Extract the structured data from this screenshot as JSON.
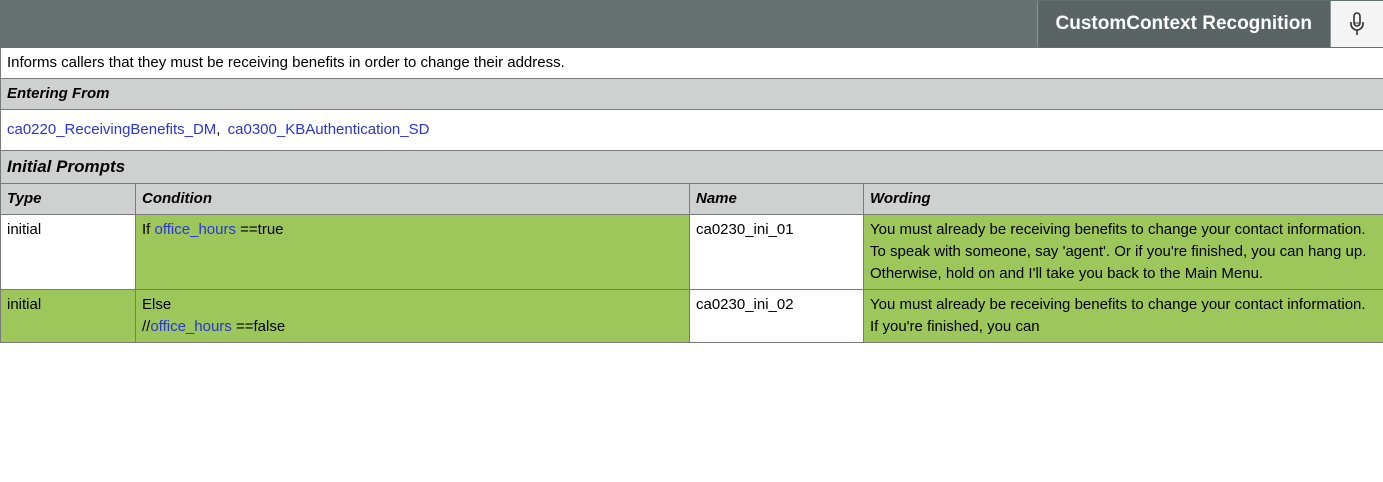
{
  "header": {
    "title": "CustomContext Recognition",
    "icon": "microphone-icon"
  },
  "description": "Informs callers that they must be receiving benefits in order to change their address.",
  "entering_from": {
    "label": "Entering From",
    "links": [
      "ca0220_ReceivingBenefits_DM",
      "ca0300_KBAuthentication_SD"
    ],
    "separator": ","
  },
  "initial_prompts": {
    "label": "Initial Prompts",
    "columns": [
      "Type",
      "Condition",
      "Name",
      "Wording"
    ],
    "rows": [
      {
        "type": "initial",
        "condition_prefix": "If ",
        "condition_link": "office_hours",
        "condition_suffix": " ==true",
        "name": "ca0230_ini_01",
        "wording": "You must already be receiving benefits to change your contact information. To speak with someone, say 'agent'. Or if you're finished, you can hang up. Otherwise, hold on and I'll take you back to the Main Menu."
      },
      {
        "type": "initial",
        "condition_line1": "Else",
        "condition_prefix2": "//",
        "condition_link2": "office_hours",
        "condition_suffix2": " ==false",
        "name": "ca0230_ini_02",
        "wording": "You must already be receiving benefits to change your contact information. If you're finished, you can"
      }
    ]
  },
  "colors": {
    "header_bg": "#667070",
    "section_bg": "#cfd1d1",
    "highlight_green": "#9dc75a",
    "link": "#2a35d9"
  }
}
